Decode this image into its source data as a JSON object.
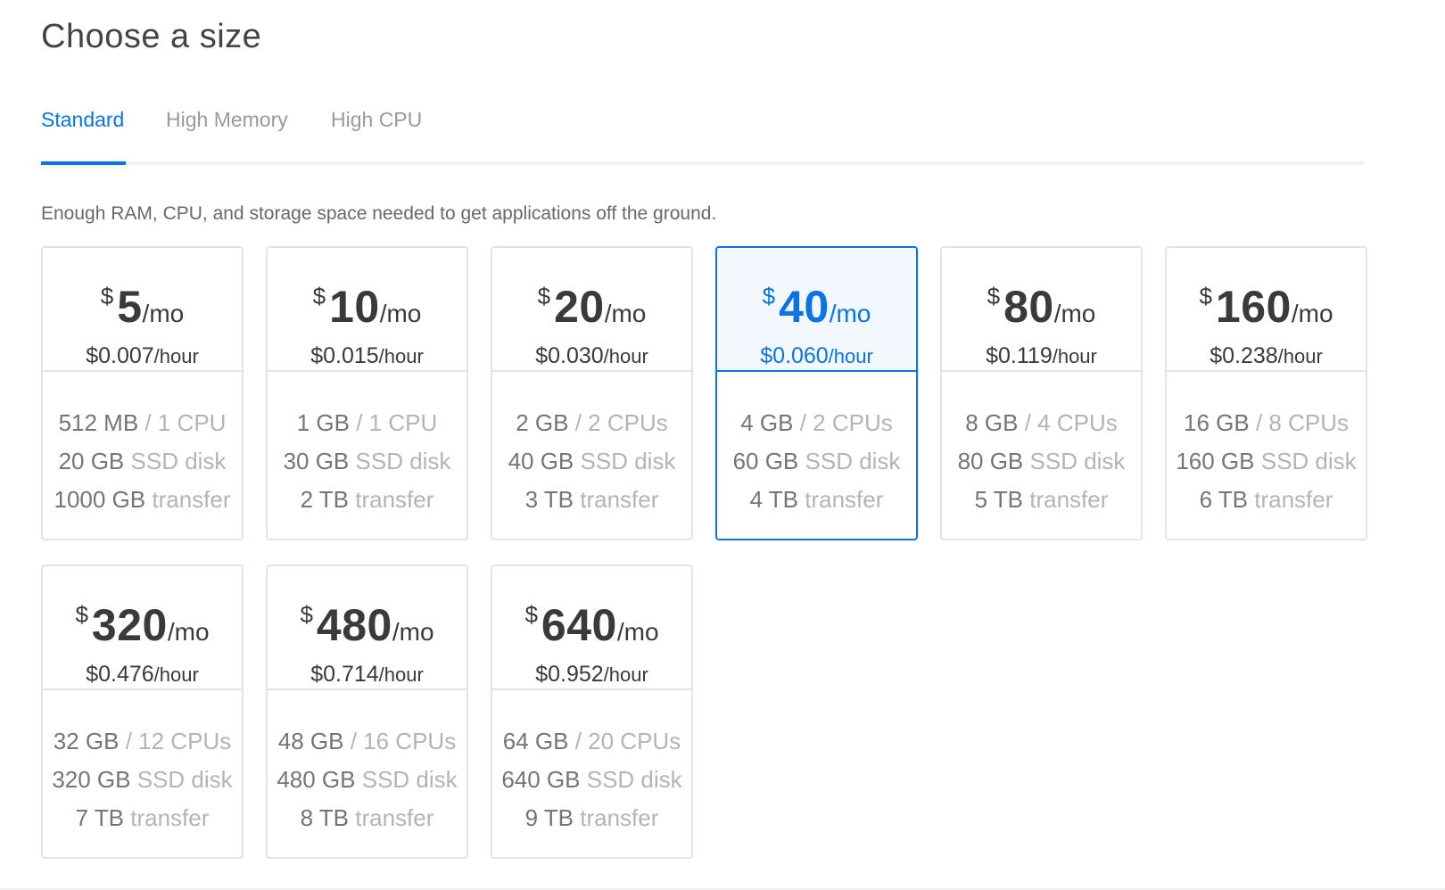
{
  "page": {
    "title": "Choose a size"
  },
  "tabs": [
    {
      "label": "Standard",
      "active": true
    },
    {
      "label": "High Memory",
      "active": false
    },
    {
      "label": "High CPU",
      "active": false
    }
  ],
  "description": "Enough RAM, CPU, and storage space needed to get applications off the ground.",
  "colors": {
    "accent": "#0a74e5",
    "selected_bg": "#f3f8ff",
    "card_border": "#e4e4e4"
  },
  "plans": [
    {
      "currency": "$",
      "monthly": "5",
      "monthly_unit": "/mo",
      "hourly": "$0.007",
      "hourly_unit": "/hour",
      "memory": "512 MB",
      "cpu": "/ 1 CPU",
      "disk": "20 GB",
      "disk_unit": "SSD disk",
      "transfer": "1000 GB",
      "transfer_unit": "transfer",
      "selected": false
    },
    {
      "currency": "$",
      "monthly": "10",
      "monthly_unit": "/mo",
      "hourly": "$0.015",
      "hourly_unit": "/hour",
      "memory": "1 GB",
      "cpu": "/ 1 CPU",
      "disk": "30 GB",
      "disk_unit": "SSD disk",
      "transfer": "2 TB",
      "transfer_unit": "transfer",
      "selected": false
    },
    {
      "currency": "$",
      "monthly": "20",
      "monthly_unit": "/mo",
      "hourly": "$0.030",
      "hourly_unit": "/hour",
      "memory": "2 GB",
      "cpu": "/ 2 CPUs",
      "disk": "40 GB",
      "disk_unit": "SSD disk",
      "transfer": "3 TB",
      "transfer_unit": "transfer",
      "selected": false
    },
    {
      "currency": "$",
      "monthly": "40",
      "monthly_unit": "/mo",
      "hourly": "$0.060",
      "hourly_unit": "/hour",
      "memory": "4 GB",
      "cpu": "/ 2 CPUs",
      "disk": "60 GB",
      "disk_unit": "SSD disk",
      "transfer": "4 TB",
      "transfer_unit": "transfer",
      "selected": true
    },
    {
      "currency": "$",
      "monthly": "80",
      "monthly_unit": "/mo",
      "hourly": "$0.119",
      "hourly_unit": "/hour",
      "memory": "8 GB",
      "cpu": "/ 4 CPUs",
      "disk": "80 GB",
      "disk_unit": "SSD disk",
      "transfer": "5 TB",
      "transfer_unit": "transfer",
      "selected": false
    },
    {
      "currency": "$",
      "monthly": "160",
      "monthly_unit": "/mo",
      "hourly": "$0.238",
      "hourly_unit": "/hour",
      "memory": "16 GB",
      "cpu": "/ 8 CPUs",
      "disk": "160 GB",
      "disk_unit": "SSD disk",
      "transfer": "6 TB",
      "transfer_unit": "transfer",
      "selected": false
    },
    {
      "currency": "$",
      "monthly": "320",
      "monthly_unit": "/mo",
      "hourly": "$0.476",
      "hourly_unit": "/hour",
      "memory": "32 GB",
      "cpu": "/ 12 CPUs",
      "disk": "320 GB",
      "disk_unit": "SSD disk",
      "transfer": "7 TB",
      "transfer_unit": "transfer",
      "selected": false
    },
    {
      "currency": "$",
      "monthly": "480",
      "monthly_unit": "/mo",
      "hourly": "$0.714",
      "hourly_unit": "/hour",
      "memory": "48 GB",
      "cpu": "/ 16 CPUs",
      "disk": "480 GB",
      "disk_unit": "SSD disk",
      "transfer": "8 TB",
      "transfer_unit": "transfer",
      "selected": false
    },
    {
      "currency": "$",
      "monthly": "640",
      "monthly_unit": "/mo",
      "hourly": "$0.952",
      "hourly_unit": "/hour",
      "memory": "64 GB",
      "cpu": "/ 20 CPUs",
      "disk": "640 GB",
      "disk_unit": "SSD disk",
      "transfer": "9 TB",
      "transfer_unit": "transfer",
      "selected": false
    }
  ]
}
